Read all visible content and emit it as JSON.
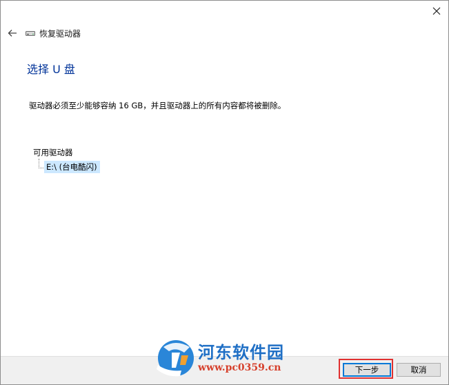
{
  "window": {
    "title": "恢复驱动器",
    "close_glyph": "✕",
    "back_glyph": "←"
  },
  "main": {
    "heading": "选择 U 盘",
    "description": "驱动器必须至少能够容纳 16 GB，并且驱动器上的所有内容都将被删除。"
  },
  "drives": {
    "group_label": "可用驱动器",
    "items": [
      {
        "label": "E:\\ (台电酷闪)",
        "selected": true
      }
    ]
  },
  "footer": {
    "next_label": "下一步",
    "cancel_label": "取消"
  },
  "watermark": {
    "name": "河东软件园",
    "url": "www.pc0359.cn"
  },
  "colors": {
    "heading": "#003399",
    "selection": "#cce8ff",
    "highlight_box": "#e03030",
    "focus_border": "#0078d7",
    "watermark_blue": "#1f6fc5",
    "watermark_red": "#d6402c"
  },
  "icons": {
    "close": "close-icon",
    "back": "back-arrow-icon",
    "drive": "usb-drive-icon",
    "logo": "hedong-logo-icon"
  }
}
